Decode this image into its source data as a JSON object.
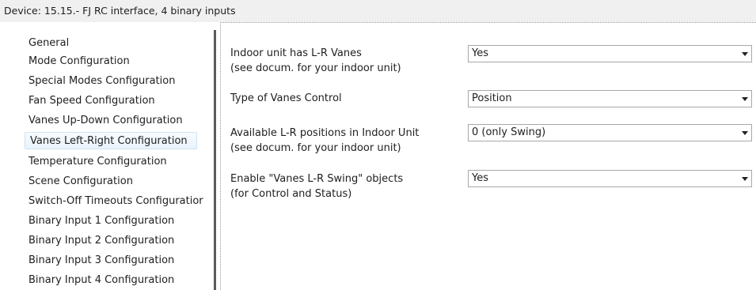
{
  "device": {
    "title": "Device: 15.15.-  FJ RC interface, 4 binary inputs"
  },
  "sidebar": {
    "items": [
      {
        "label": "General"
      },
      {
        "label": "Mode Configuration"
      },
      {
        "label": "Special Modes Configuration"
      },
      {
        "label": "Fan Speed Configuration"
      },
      {
        "label": "Vanes Up-Down Configuration"
      },
      {
        "label": "Vanes Left-Right Configuration",
        "selected": true
      },
      {
        "label": "Temperature Configuration"
      },
      {
        "label": "Scene Configuration"
      },
      {
        "label": "Switch-Off Timeouts Configuratior"
      },
      {
        "label": "Binary Input 1 Configuration"
      },
      {
        "label": "Binary Input 2 Configuration"
      },
      {
        "label": "Binary Input 3 Configuration"
      },
      {
        "label": "Binary Input 4 Configuration"
      }
    ]
  },
  "parameters": [
    {
      "label_line1": "Indoor unit has L-R Vanes",
      "label_line2": "(see docum. for your indoor unit)",
      "value": "Yes"
    },
    {
      "label_line1": "Type of Vanes Control",
      "label_line2": "",
      "value": "Position"
    },
    {
      "label_line1": "Available L-R positions in Indoor Unit",
      "label_line2": "(see docum. for your indoor unit)",
      "value": "0 (only Swing)"
    },
    {
      "label_line1": "Enable \"Vanes L-R Swing\" objects",
      "label_line2": "(for Control and Status)",
      "value": "Yes"
    }
  ],
  "icons": {
    "dropdown": "chevron-down-icon"
  }
}
